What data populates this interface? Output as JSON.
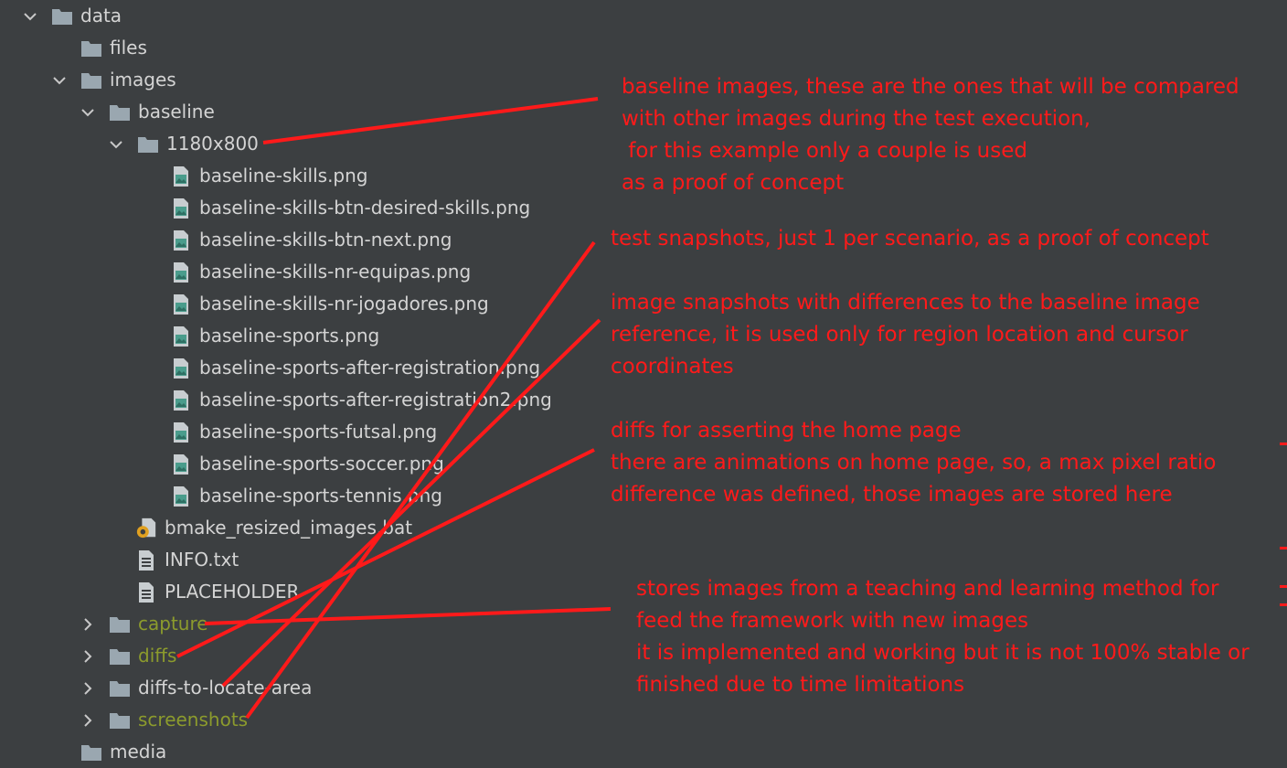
{
  "tree": [
    {
      "label": "data",
      "type": "folder",
      "expanded": true,
      "depth": 0,
      "muted": false
    },
    {
      "label": "files",
      "type": "folder",
      "expanded": null,
      "depth": 1,
      "muted": false
    },
    {
      "label": "images",
      "type": "folder",
      "expanded": true,
      "depth": 1,
      "muted": false
    },
    {
      "label": "baseline",
      "type": "folder",
      "expanded": true,
      "depth": 2,
      "muted": false
    },
    {
      "label": "1180x800",
      "type": "folder",
      "expanded": true,
      "depth": 3,
      "muted": false
    },
    {
      "label": "baseline-skills.png",
      "type": "image",
      "depth": 5,
      "muted": false
    },
    {
      "label": "baseline-skills-btn-desired-skills.png",
      "type": "image",
      "depth": 5,
      "muted": false
    },
    {
      "label": "baseline-skills-btn-next.png",
      "type": "image",
      "depth": 5,
      "muted": false
    },
    {
      "label": "baseline-skills-nr-equipas.png",
      "type": "image",
      "depth": 5,
      "muted": false
    },
    {
      "label": "baseline-skills-nr-jogadores.png",
      "type": "image",
      "depth": 5,
      "muted": false
    },
    {
      "label": "baseline-sports.png",
      "type": "image",
      "depth": 5,
      "muted": false
    },
    {
      "label": "baseline-sports-after-registration.png",
      "type": "image",
      "depth": 5,
      "muted": false
    },
    {
      "label": "baseline-sports-after-registration2.png",
      "type": "image",
      "depth": 5,
      "muted": false
    },
    {
      "label": "baseline-sports-futsal.png",
      "type": "image",
      "depth": 5,
      "muted": false
    },
    {
      "label": "baseline-sports-soccer.png",
      "type": "image",
      "depth": 5,
      "muted": false
    },
    {
      "label": "baseline-sports-tennis.png",
      "type": "image",
      "depth": 5,
      "muted": false
    },
    {
      "label": "bmake_resized_images.bat",
      "type": "batch",
      "depth": 4,
      "muted": false
    },
    {
      "label": "INFO.txt",
      "type": "text",
      "depth": 4,
      "muted": false
    },
    {
      "label": "PLACEHOLDER",
      "type": "text",
      "depth": 4,
      "muted": false
    },
    {
      "label": "capture",
      "type": "folder",
      "expanded": false,
      "depth": 2,
      "muted": true
    },
    {
      "label": "diffs",
      "type": "folder",
      "expanded": false,
      "depth": 2,
      "muted": true
    },
    {
      "label": "diffs-to-locate-area",
      "type": "folder",
      "expanded": false,
      "depth": 2,
      "muted": false
    },
    {
      "label": "screenshots",
      "type": "folder",
      "expanded": false,
      "depth": 2,
      "muted": true
    },
    {
      "label": "media",
      "type": "folder",
      "expanded": null,
      "depth": 1,
      "muted": false
    }
  ],
  "annotations": [
    {
      "lines": [
        "baseline images, these are the ones that will be compared",
        "with other images during the test execution,",
        " for this example only a couple is used",
        "as a proof of concept"
      ]
    },
    {
      "lines": [
        "test snapshots, just 1 per scenario, as a proof of concept"
      ]
    },
    {
      "lines": [
        "image snapshots with differences to the baseline image",
        "reference, it is used only for region location and cursor",
        "coordinates"
      ]
    },
    {
      "lines": [
        "diffs for asserting the home page",
        "there are animations on home page, so, a max pixel ratio",
        "difference was defined, those images are stored here"
      ]
    },
    {
      "lines": [
        "stores images from a teaching and learning method for",
        "feed the framework with new images",
        "it is implemented and working but it is not 100% stable or",
        "finished due to time limitations"
      ]
    }
  ],
  "colors": {
    "background": "#3c3f41",
    "text": "#d4d4d4",
    "muted_text": "#8c9b2d",
    "annotation": "#ff1a1a",
    "folder_icon": "#9aa7b0",
    "image_icon": "#4a9c8c"
  }
}
